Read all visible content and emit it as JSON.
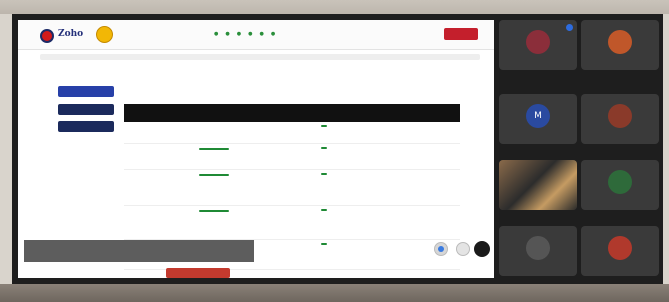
{
  "presentation": {
    "logo_text": "Zoho",
    "nav_links": [
      "",
      "",
      "",
      "",
      "",
      ""
    ],
    "logout_label": "",
    "sidebar_buttons": [
      "",
      "",
      ""
    ],
    "page_title": "",
    "table": {
      "headers": [
        "",
        "",
        "",
        "",
        "",
        "",
        "",
        ""
      ],
      "rows": [
        {
          "action": "",
          "status": ""
        },
        {
          "action": "",
          "status": ""
        },
        {
          "action": "",
          "status": ""
        },
        {
          "action": "",
          "status": ""
        },
        {
          "action": "",
          "status": ""
        }
      ]
    }
  },
  "participants": [
    {
      "name": "",
      "avatar_color": "#8b2e3a"
    },
    {
      "name": "",
      "avatar_color": "#c0572a"
    },
    {
      "name": "",
      "avatar_color": "#2a4aa0",
      "initials": "M"
    },
    {
      "name": "",
      "avatar_color": "#8a3a2a"
    },
    {
      "name": "",
      "avatar_color": null
    },
    {
      "name": "",
      "avatar_color": "#2e6a3a"
    },
    {
      "name": "",
      "avatar_color": "#555555"
    },
    {
      "name": "",
      "avatar_color": "#b0392c"
    }
  ],
  "colors": {
    "accent_blue": "#2740a8",
    "button_green": "#1f8a35",
    "logout_red": "#c41f2c",
    "meeting_bg": "#1e1e1e"
  }
}
